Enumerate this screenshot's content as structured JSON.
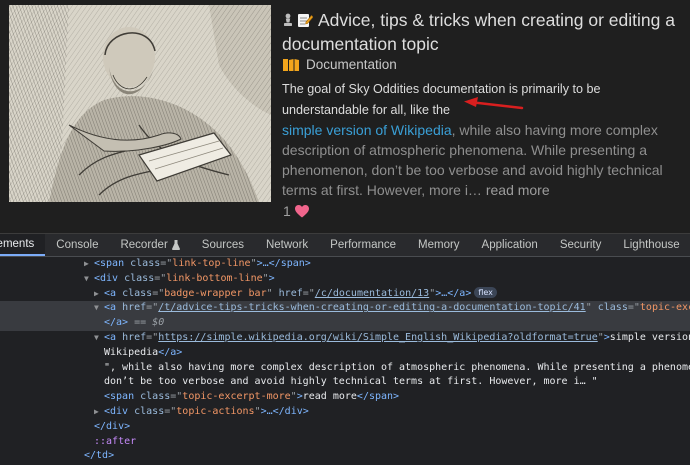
{
  "topic": {
    "title": "Advice, tips & tricks when creating or editing a documentation topic",
    "pin_icon": "chess-pawn-icon",
    "title_emoji_icon": "memo-pencil-icon",
    "category": {
      "label": "Documentation",
      "icon": "category-badge-icon",
      "color": "#f2a51c"
    },
    "excerpt": {
      "lead": "The goal of Sky Oddities documentation is primarily to be understandable for all, like the",
      "link": "simple version of Wikipedia",
      "rest": ", while also having more complex description of atmospheric phenomena. While presenting a phenomenon, don’t be too verbose and avoid highly technical terms at first. However, more i…",
      "more": "read more"
    },
    "likes": {
      "count": "1",
      "icon": "heart-icon",
      "color": "#f0658c"
    },
    "annotation_arrow_color": "#d81f1f"
  },
  "devtools": {
    "tabs": [
      "lements",
      "Console",
      "Recorder",
      "Sources",
      "Network",
      "Performance",
      "Memory",
      "Application",
      "Security",
      "Lighthouse"
    ],
    "recorder_icon": "flask-icon",
    "lines": [
      {
        "open": "<span",
        "attr": "class",
        "val": "link-top-line",
        "close": ">…</span>"
      },
      {
        "open": "<div",
        "attr": "class",
        "val": "link-bottom-line",
        "close": ">"
      },
      {
        "open": "<a",
        "attr": "class",
        "val": "badge-wrapper bar",
        "attr2": "href",
        "val2": "/c/documentation/13",
        "close": ">…</a>",
        "badge": "flex"
      },
      {
        "open": "<a",
        "attr": "href",
        "val": "/t/advice-tips-tricks-when-creating-or-editing-a-documentation-topic/41",
        "attr2": "class",
        "val2": "topic-excerpt"
      },
      {
        "close_tag": "</a>",
        "eq": "==",
        "ref": "$0"
      },
      {
        "open": "<a",
        "attr": "href",
        "val": "https://simple.wikipedia.org/wiki/Simple_English_Wikipedia?oldformat=true",
        "close": ">",
        "text": "simple version of"
      },
      {
        "text": "Wikipedia",
        "close": "</a>"
      },
      {
        "text": "\", while also having more complex description of atmospheric phenomena. While presenting a phenomenon,"
      },
      {
        "text": "don’t be too verbose and avoid highly technical terms at first. However, more i… \""
      },
      {
        "open": "<span",
        "attr": "class",
        "val": "topic-excerpt-more",
        "close": ">",
        "text": "read more",
        "close2": "</span>"
      },
      {
        "open": "<div",
        "attr": "class",
        "val": "topic-actions",
        "close": ">…</div>"
      },
      {
        "close_tag": "</div>"
      },
      {
        "pseudo": "::after"
      },
      {
        "close_tag": "</td>"
      }
    ]
  }
}
